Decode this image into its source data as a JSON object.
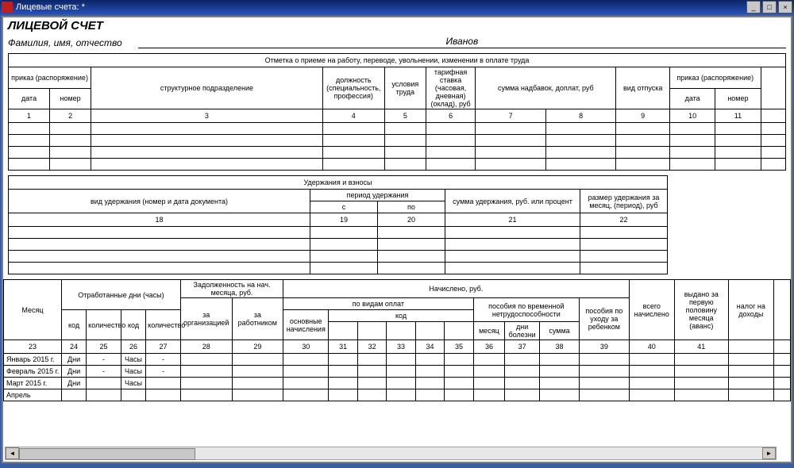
{
  "window": {
    "title": "Лицевые счета: *"
  },
  "page_title": "ЛИЦЕВОЙ СЧЕТ",
  "fio_label": "Фамилия, имя, отчество",
  "fio_value": "Иванов",
  "section1": {
    "caption": "Отметка о приеме на работу, переводе, увольнении, изменении в оплате труда",
    "cols": {
      "prikaz": "приказ (распоряжение)",
      "date": "дата",
      "number": "номер",
      "struct": "структурное подразделение",
      "position": "должность (специальность, профессия)",
      "conditions": "условия труда",
      "tariff": "тарифная ставка (часовая, дневная) (оклад), руб",
      "addons": "сумма надбавок, доплат, руб",
      "vacation": "вид отпуска",
      "prikaz2": "приказ (распоряжение)",
      "nums": [
        "1",
        "2",
        "3",
        "4",
        "5",
        "6",
        "7",
        "8",
        "9",
        "10",
        "11"
      ]
    }
  },
  "section2": {
    "caption": "Удержания и взносы",
    "cols": {
      "type": "вид удержания (номер и дата документа)",
      "period": "период удержания",
      "from": "с",
      "to": "по",
      "amount": "сумма удержания, руб. или процент",
      "monthly": "размер удержания за месяц, (период), руб",
      "nums": [
        "18",
        "19",
        "20",
        "21",
        "22"
      ]
    }
  },
  "section3": {
    "cols": {
      "month": "Месяц",
      "worked": "Отработанные дни (часы)",
      "kod": "код",
      "qty": "количество",
      "debt": "Задолженность на нач. месяца, руб.",
      "by_org": "за организацией",
      "by_emp": "за работником",
      "accrued": "Начислено, руб.",
      "by_payment": "по видам оплат",
      "main_accr": "основные начисления",
      "sick_benefit": "пособия по временной нетрудоспособности",
      "month2": "месяц",
      "sick_days": "дни болезни",
      "sum": "сумма",
      "care_benefit": "пособия по уходу за ребенком",
      "total_accr": "всего начислено",
      "advance": "выдано за первую половину месяца (аванс)",
      "tax": "налог на доходы",
      "nums": [
        "23",
        "24",
        "25",
        "26",
        "27",
        "28",
        "29",
        "30",
        "31",
        "32",
        "33",
        "34",
        "35",
        "36",
        "37",
        "38",
        "39",
        "40",
        "41"
      ]
    },
    "rows": [
      {
        "month": "Январь 2015 г.",
        "c1": "Дни",
        "v1": "-",
        "c2": "Часы",
        "v2": "-"
      },
      {
        "month": "Февраль 2015 г.",
        "c1": "Дни",
        "v1": "-",
        "c2": "Часы",
        "v2": "-"
      },
      {
        "month": "Март 2015 г.",
        "c1": "Дни",
        "v1": "",
        "c2": "Часы",
        "v2": ""
      },
      {
        "month": "Апрель",
        "c1": "",
        "v1": "",
        "c2": "",
        "v2": ""
      }
    ]
  }
}
